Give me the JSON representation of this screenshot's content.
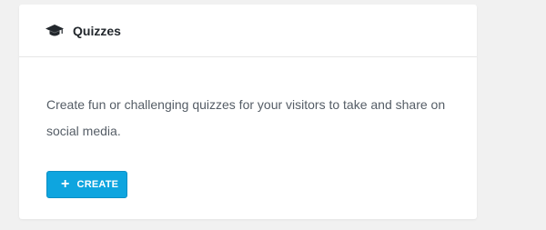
{
  "card": {
    "icon": "graduation-cap-icon",
    "title": "Quizzes",
    "description": "Create fun or challenging quizzes for your visitors to take and share on social media.",
    "create_button": {
      "icon_glyph": "+",
      "label": "CREATE"
    }
  },
  "colors": {
    "page_background": "#f1f1f1",
    "card_background": "#ffffff",
    "accent": "#0ea5df",
    "title_text": "#23282d",
    "body_text": "#555d66"
  }
}
